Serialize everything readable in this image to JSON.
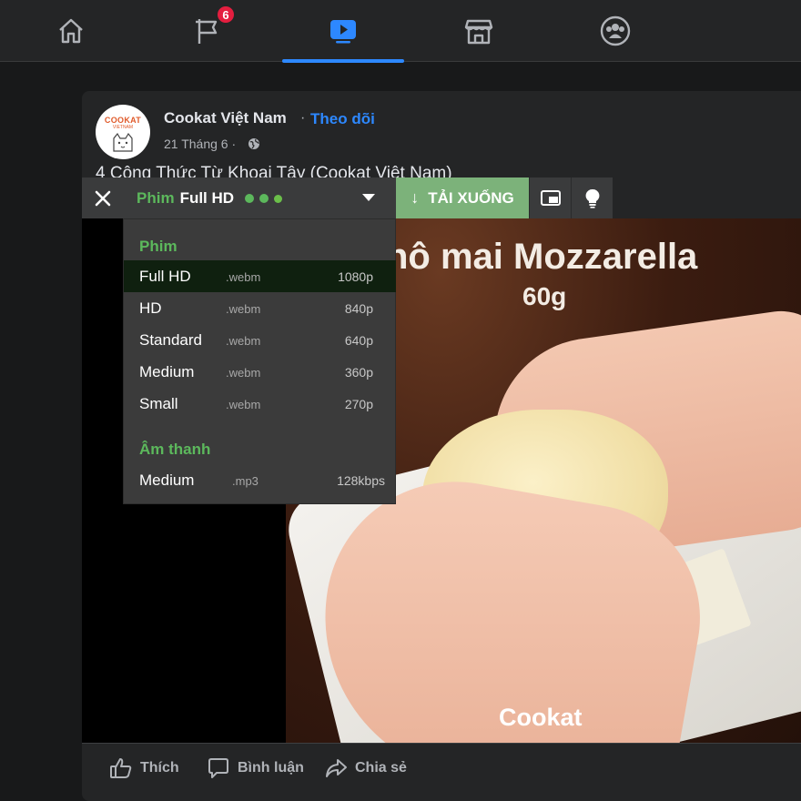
{
  "nav": {
    "items": [
      {
        "name": "home",
        "icon": "home-icon"
      },
      {
        "name": "pages",
        "icon": "flag-icon",
        "badge": "6"
      },
      {
        "name": "watch",
        "icon": "video-play-icon",
        "active": true
      },
      {
        "name": "marketplace",
        "icon": "store-icon"
      },
      {
        "name": "groups",
        "icon": "groups-icon"
      }
    ],
    "active_color": "#2d88ff",
    "badge_color": "#e41e3f"
  },
  "post": {
    "avatar": {
      "line1": "COOKAT",
      "line2": "VIETNAM"
    },
    "author": "Cookat Việt Nam",
    "separator": "·",
    "follow_label": "Theo dõi",
    "date": "21 Tháng 6 ·",
    "title": "4 Công Thức Từ Khoai Tây (Cookat Việt Nam)"
  },
  "video": {
    "overlay_line1": "hô mai Mozzarella",
    "overlay_line2": "60g",
    "watermark": "Cookat"
  },
  "downloader": {
    "close_label": "✕",
    "format_label": "Phim",
    "quality_label": "Full HD",
    "download_label": "TẢI XUỐNG",
    "download_arrow": "↓",
    "accent_color": "#5cb85c",
    "button_color": "#7cb27a",
    "menu": {
      "video_header": "Phim",
      "video_options": [
        {
          "name": "Full HD",
          "ext": ".webm",
          "res": "1080p",
          "selected": true
        },
        {
          "name": "HD",
          "ext": ".webm",
          "res": "840p"
        },
        {
          "name": "Standard",
          "ext": ".webm",
          "res": "640p"
        },
        {
          "name": "Medium",
          "ext": ".webm",
          "res": "360p"
        },
        {
          "name": "Small",
          "ext": ".webm",
          "res": "270p"
        }
      ],
      "audio_header": "Âm thanh",
      "audio_options": [
        {
          "name": "Medium",
          "ext": ".mp3",
          "res": "128kbps"
        }
      ]
    }
  },
  "actions": {
    "like": "Thích",
    "comment": "Bình luận",
    "share": "Chia sẻ"
  }
}
